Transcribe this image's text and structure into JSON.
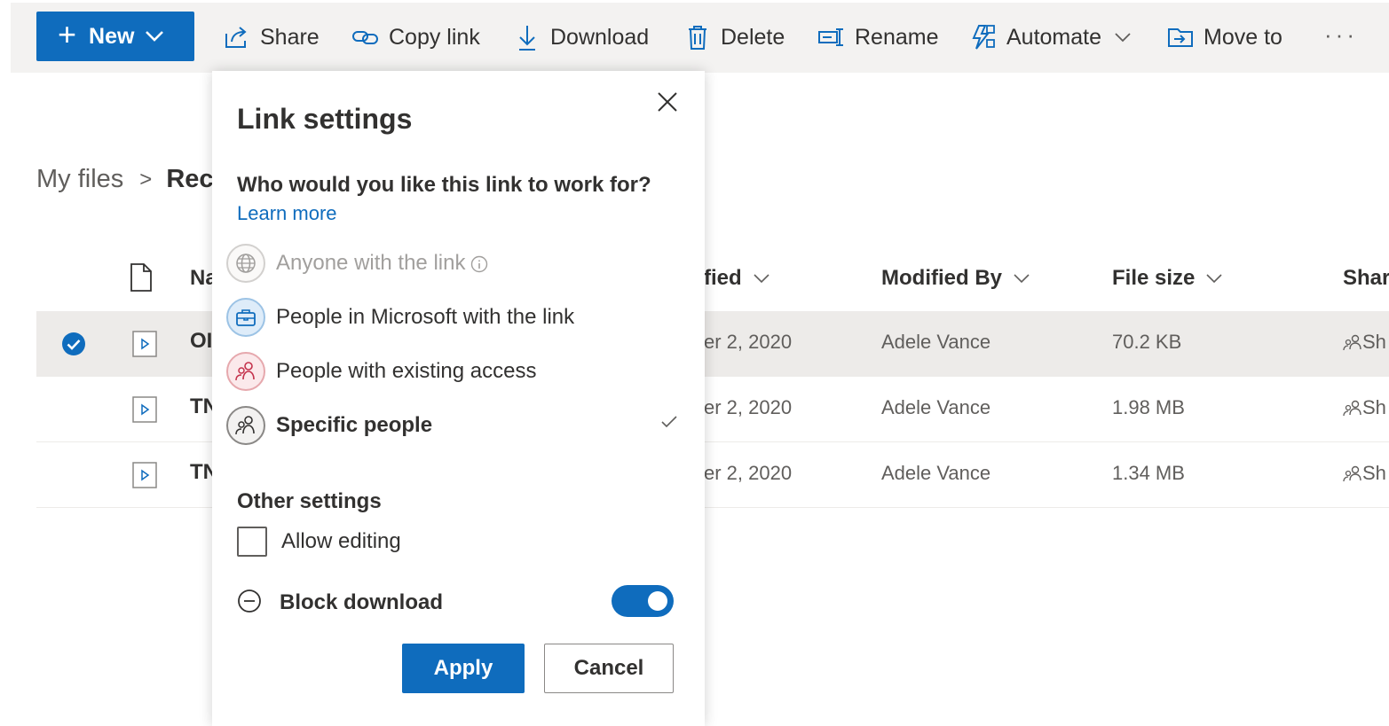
{
  "toolbar": {
    "new_label": "New",
    "share_label": "Share",
    "copy_link_label": "Copy link",
    "download_label": "Download",
    "delete_label": "Delete",
    "rename_label": "Rename",
    "automate_label": "Automate",
    "move_to_label": "Move to",
    "more_label": "···",
    "accent": "#0f6cbd"
  },
  "breadcrumb": {
    "root": "My files",
    "separator": ">",
    "current": "Rec"
  },
  "table": {
    "headers": {
      "name": "Na",
      "modified": "fied",
      "modified_by": "Modified By",
      "file_size": "File size",
      "sharing": "Shari"
    },
    "rows": [
      {
        "name": "OI",
        "modified": "er 2, 2020",
        "modified_by": "Adele Vance",
        "file_size": "70.2 KB",
        "sharing": "Sh",
        "selected": true
      },
      {
        "name": "TN",
        "modified": "er 2, 2020",
        "modified_by": "Adele Vance",
        "file_size": "1.98 MB",
        "sharing": "Sh",
        "selected": false
      },
      {
        "name": "TN",
        "modified": "er 2, 2020",
        "modified_by": "Adele Vance",
        "file_size": "1.34 MB",
        "sharing": "Sh",
        "selected": false
      }
    ]
  },
  "panel": {
    "title": "Link settings",
    "question": "Who would you like this link to work for?",
    "learn_more": "Learn more",
    "options": [
      {
        "label": "Anyone with the link",
        "icon": "globe-icon",
        "disabled": true,
        "selected": false
      },
      {
        "label": "People in Microsoft with the link",
        "icon": "briefcase-icon",
        "disabled": false,
        "selected": false
      },
      {
        "label": "People with existing access",
        "icon": "people-icon",
        "disabled": false,
        "selected": false
      },
      {
        "label": "Specific people",
        "icon": "people-icon",
        "disabled": false,
        "selected": true
      }
    ],
    "other_settings_title": "Other settings",
    "allow_editing_label": "Allow editing",
    "allow_editing_checked": false,
    "block_download_label": "Block download",
    "block_download_on": true,
    "apply_label": "Apply",
    "cancel_label": "Cancel"
  }
}
